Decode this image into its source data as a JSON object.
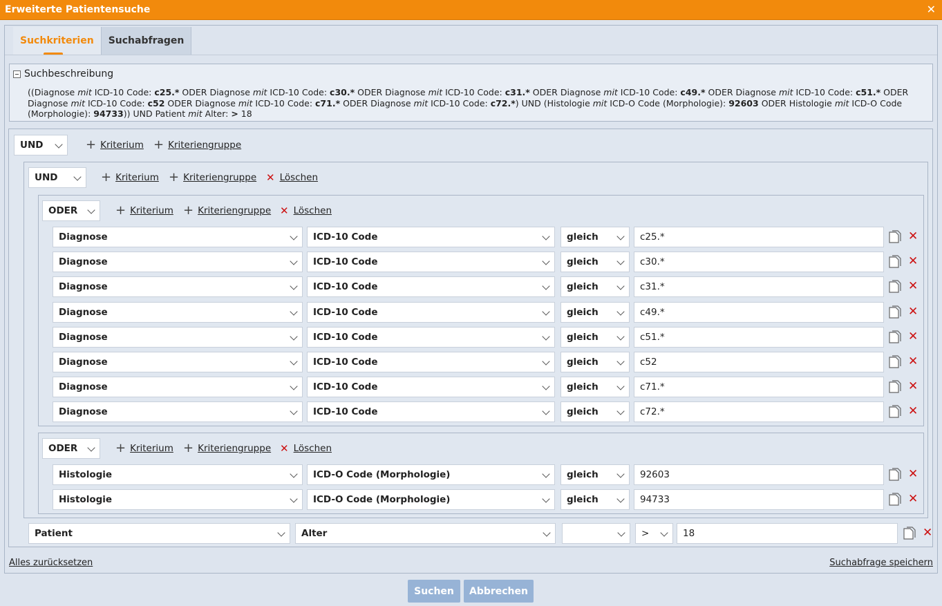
{
  "window": {
    "title": "Erweiterte Patientensuche",
    "close": "✕"
  },
  "tabs": [
    {
      "label": "Suchkriterien"
    },
    {
      "label": "Suchabfragen"
    }
  ],
  "description": {
    "header": "Suchbeschreibung",
    "text": "((Diagnose mit ICD-10 Code: c25.* ODER Diagnose mit ICD-10 Code: c30.* ODER Diagnose mit ICD-10 Code: c31.* ODER Diagnose mit ICD-10 Code: c49.* ODER Diagnose mit ICD-10 Code: c51.* ODER Diagnose mit ICD-10 Code: c52 ODER Diagnose mit ICD-10 Code: c71.* ODER Diagnose mit ICD-10 Code: c72.*) UND (Histologie mit ICD-O Code (Morphologie): 92603 ODER Histologie mit ICD-O Code (Morphologie): 94733)) UND Patient mit Alter: > 18"
  },
  "actions": {
    "criterion": "Kriterium",
    "group": "Kriteriengruppe",
    "delete": "Löschen"
  },
  "root": {
    "operator": "UND"
  },
  "sub1": {
    "operator": "UND"
  },
  "groupA": {
    "operator": "ODER",
    "rows": [
      {
        "entity": "Diagnose",
        "field": "ICD-10 Code",
        "op": "gleich",
        "value": "c25.*"
      },
      {
        "entity": "Diagnose",
        "field": "ICD-10 Code",
        "op": "gleich",
        "value": "c30.*"
      },
      {
        "entity": "Diagnose",
        "field": "ICD-10 Code",
        "op": "gleich",
        "value": "c31.*"
      },
      {
        "entity": "Diagnose",
        "field": "ICD-10 Code",
        "op": "gleich",
        "value": "c49.*"
      },
      {
        "entity": "Diagnose",
        "field": "ICD-10 Code",
        "op": "gleich",
        "value": "c51.*"
      },
      {
        "entity": "Diagnose",
        "field": "ICD-10 Code",
        "op": "gleich",
        "value": "c52"
      },
      {
        "entity": "Diagnose",
        "field": "ICD-10 Code",
        "op": "gleich",
        "value": "c71.*"
      },
      {
        "entity": "Diagnose",
        "field": "ICD-10 Code",
        "op": "gleich",
        "value": "c72.*"
      }
    ]
  },
  "groupB": {
    "operator": "ODER",
    "rows": [
      {
        "entity": "Histologie",
        "field": "ICD-O Code (Morphologie)",
        "op": "gleich",
        "value": "92603"
      },
      {
        "entity": "Histologie",
        "field": "ICD-O Code (Morphologie)",
        "op": "gleich",
        "value": "94733"
      }
    ]
  },
  "patientRow": {
    "entity": "Patient",
    "field": "Alter",
    "unit": "",
    "op": ">",
    "value": "18"
  },
  "footer": {
    "reset": "Alles zurücksetzen",
    "save": "Suchabfrage speichern",
    "search": "Suchen",
    "cancel": "Abbrechen"
  },
  "colors": {
    "accent": "#f28a0c",
    "delete": "#cc1111",
    "button": "#97b3d6"
  }
}
